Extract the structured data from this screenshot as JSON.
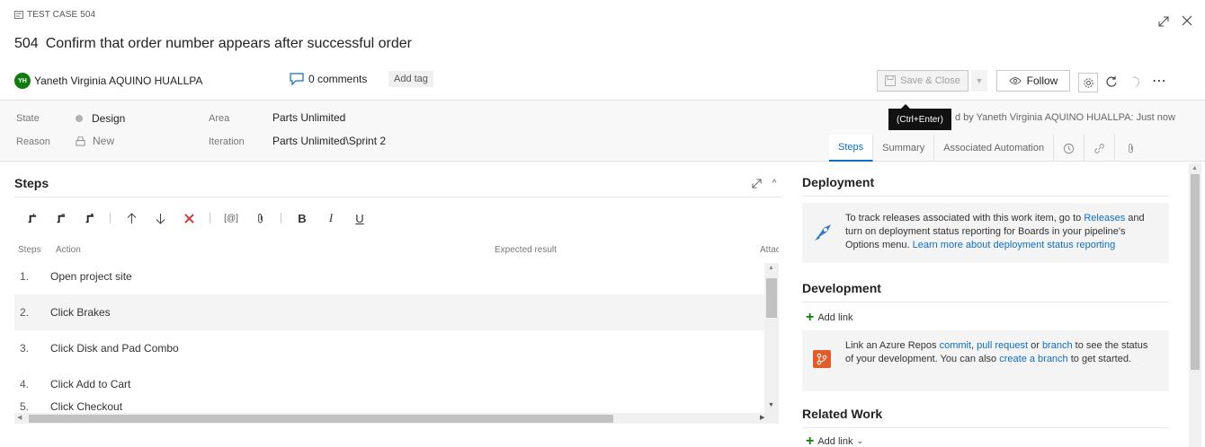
{
  "header": {
    "type_label": "TEST CASE 504",
    "work_item_id": "504",
    "title": "Confirm that order number appears after successful order",
    "user_initials": "YH",
    "user_name": "Yaneth Virginia AQUINO HUALLPA",
    "comments": "0 comments",
    "add_tag": "Add tag",
    "save_close": "Save & Close",
    "follow": "Follow",
    "tooltip": "(Ctrl+Enter)"
  },
  "fields": {
    "state_label": "State",
    "state_value": "Design",
    "reason_label": "Reason",
    "reason_value": "New",
    "area_label": "Area",
    "area_value": "Parts Unlimited",
    "iteration_label": "Iteration",
    "iteration_value": "Parts Unlimited\\Sprint 2",
    "changed_text": "d by Yaneth Virginia AQUINO HUALLPA: Just now"
  },
  "tabs": {
    "steps": "Steps",
    "summary": "Summary",
    "automation": "Associated Automation"
  },
  "steps": {
    "title": "Steps",
    "col_steps": "Steps",
    "col_action": "Action",
    "col_expected": "Expected result",
    "col_attach": "Attac",
    "toolbar": {
      "parameter": "[@]",
      "bold": "B",
      "italic": "I",
      "underline": "U"
    },
    "rows": [
      {
        "num": "1.",
        "action": "Open project site"
      },
      {
        "num": "2.",
        "action": "Click Brakes"
      },
      {
        "num": "3.",
        "action": "Click Disk and Pad Combo"
      },
      {
        "num": "4.",
        "action": "Click Add to Cart"
      },
      {
        "num": "5.",
        "action": "Click Checkout"
      }
    ]
  },
  "deployment": {
    "title": "Deployment",
    "text_1": "To track releases associated with this work item, go to ",
    "link_releases": "Releases",
    "text_2": " and turn on deployment status reporting for Boards in your pipeline's Options menu. ",
    "link_learn": "Learn more about deployment status reporting"
  },
  "development": {
    "title": "Development",
    "add_link": "Add link",
    "text_1": "Link an Azure Repos ",
    "link_commit": "commit",
    "text_2": ", ",
    "link_pr": "pull request",
    "text_3": " or ",
    "link_branch": "branch",
    "text_4": " to see the status of your development. You can also ",
    "link_create": "create a branch",
    "text_5": " to get started."
  },
  "related": {
    "title": "Related Work",
    "add_link": "Add link"
  },
  "colors": {
    "accent": "#106ebe",
    "avatar": "#107c10",
    "add_green": "#107c10"
  }
}
